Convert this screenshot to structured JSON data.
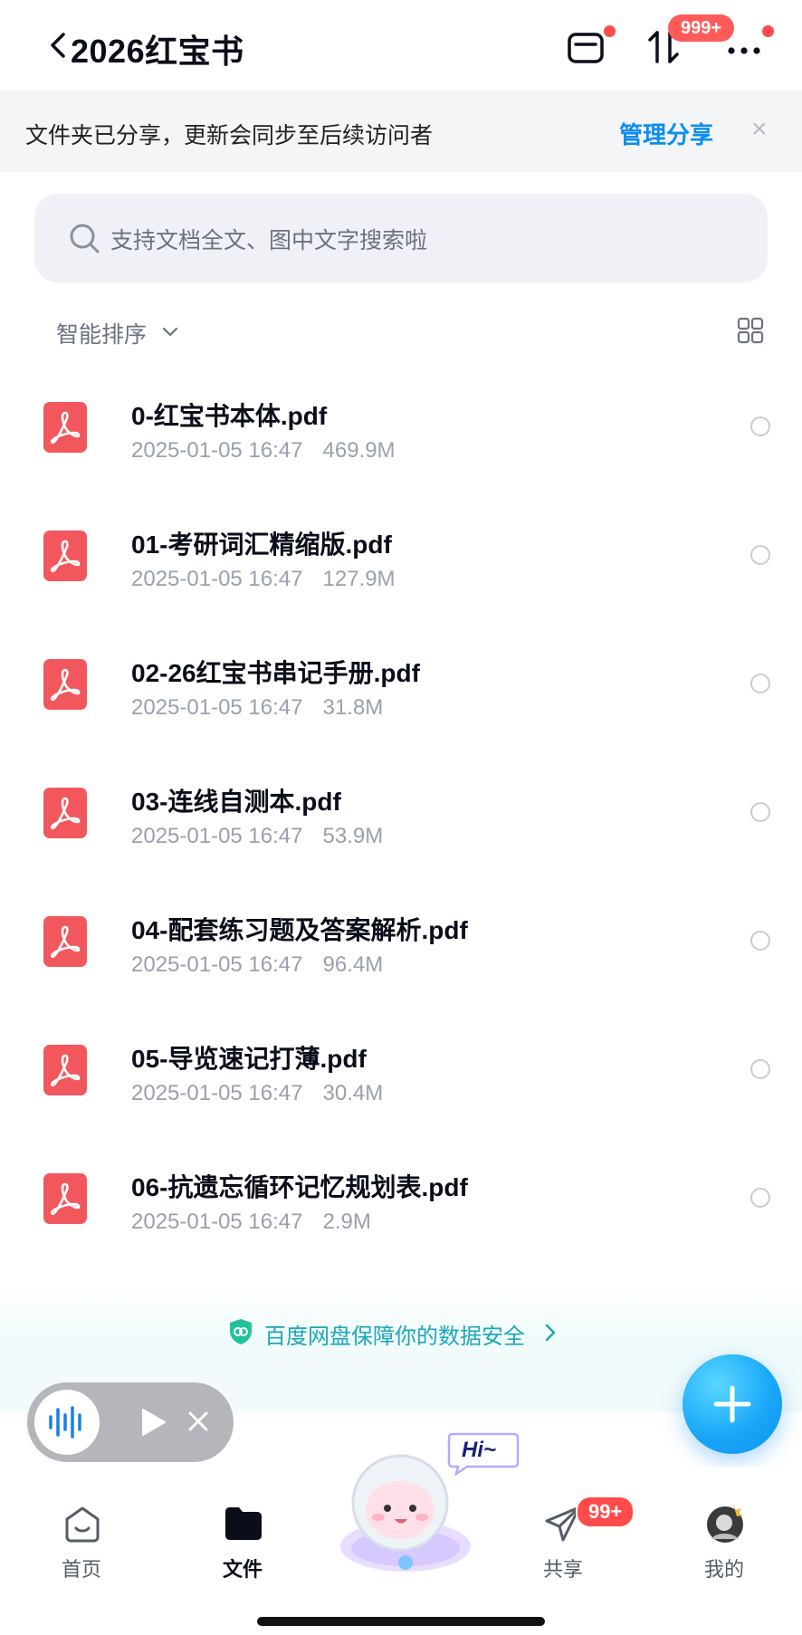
{
  "header": {
    "title": "2026红宝书",
    "transfer_badge": "999+"
  },
  "notice": {
    "text": "文件夹已分享，更新会同步至后续访问者",
    "link_label": "管理分享",
    "close_glyph": "×"
  },
  "search": {
    "placeholder": "支持文档全文、图中文字搜索啦"
  },
  "sort": {
    "label": "智能排序"
  },
  "files": [
    {
      "name": "0-红宝书本体.pdf",
      "date": "2025-01-05 16:47",
      "size": "469.9M"
    },
    {
      "name": "01-考研词汇精缩版.pdf",
      "date": "2025-01-05 16:47",
      "size": "127.9M"
    },
    {
      "name": "02-26红宝书串记手册.pdf",
      "date": "2025-01-05 16:47",
      "size": "31.8M"
    },
    {
      "name": "03-连线自测本.pdf",
      "date": "2025-01-05 16:47",
      "size": "53.9M"
    },
    {
      "name": "04-配套练习题及答案解析.pdf",
      "date": "2025-01-05 16:47",
      "size": "96.4M"
    },
    {
      "name": "05-导览速记打薄.pdf",
      "date": "2025-01-05 16:47",
      "size": "30.4M"
    },
    {
      "name": "06-抗遗忘循环记忆规划表.pdf",
      "date": "2025-01-05 16:47",
      "size": "2.9M"
    }
  ],
  "security_banner": {
    "text": "百度网盘保障你的数据安全"
  },
  "mascot": {
    "bubble_text": "Hi~"
  },
  "tabs": [
    {
      "label": "首页",
      "icon": "home-icon"
    },
    {
      "label": "文件",
      "icon": "folder-icon"
    },
    {
      "label": "共享",
      "icon": "share-icon"
    },
    {
      "label": "我的",
      "icon": "avatar"
    }
  ],
  "share_badge": "99+",
  "colors": {
    "accent": "#0b8df0",
    "pdf_red": "#f2575d",
    "badge_red": "#ff4b4b",
    "security_teal": "#1ba7b8"
  }
}
